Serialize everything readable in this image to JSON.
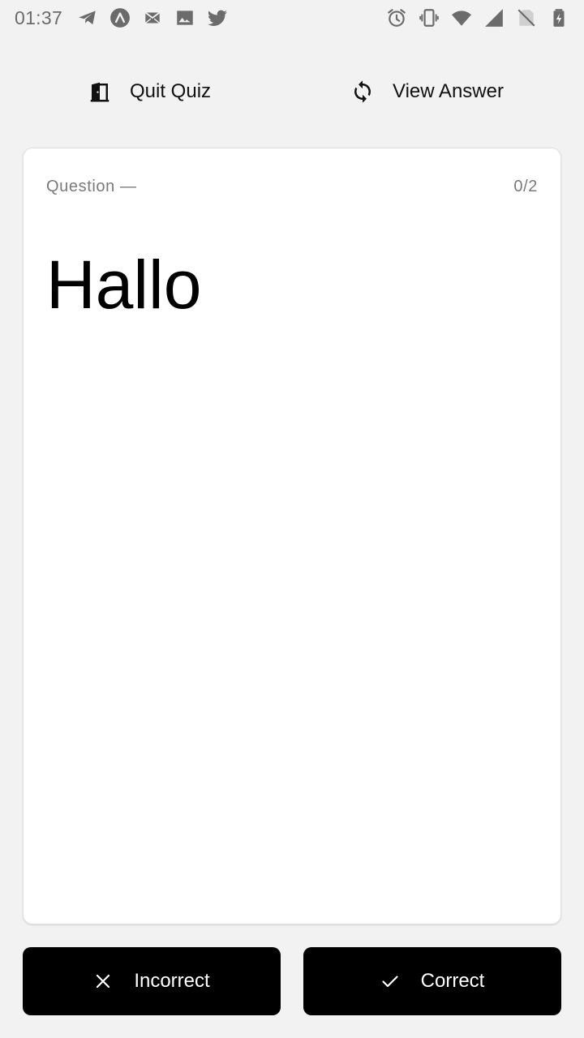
{
  "status_bar": {
    "time": "01:37",
    "left_icons": [
      "telegram-icon",
      "app-launcher-icon",
      "mail-icon",
      "image-icon",
      "twitter-icon"
    ],
    "right_icons": [
      "alarm-icon",
      "vibrate-icon",
      "wifi-icon",
      "cell-signal-icon",
      "no-sim-icon",
      "battery-charging-icon"
    ]
  },
  "actions": {
    "quit_label": "Quit Quiz",
    "view_label": "View Answer"
  },
  "card": {
    "label": "Question —",
    "progress": "0/2",
    "word": "Hallo"
  },
  "buttons": {
    "incorrect_label": "Incorrect",
    "correct_label": "Correct"
  },
  "colors": {
    "background": "#f2f2f2",
    "card": "#ffffff",
    "button": "#000000",
    "button_text": "#ffffff",
    "muted_text": "#7a7a7a"
  }
}
